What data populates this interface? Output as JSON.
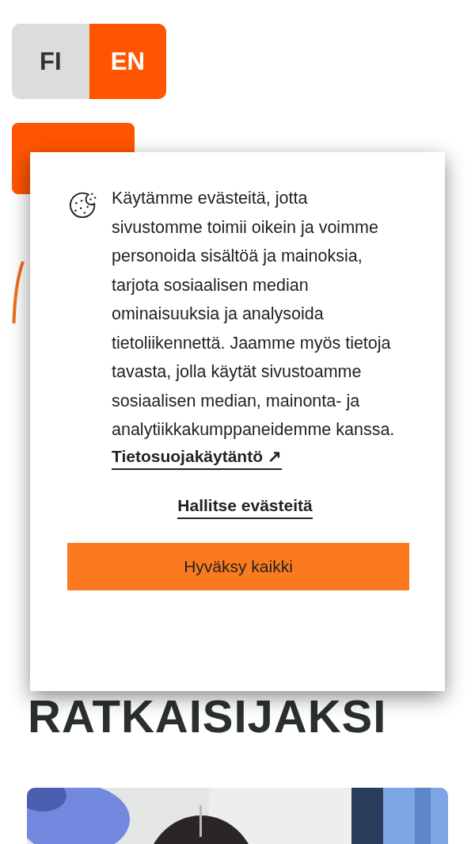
{
  "language_switch": [
    {
      "label": "FI",
      "selected": false
    },
    {
      "label": "EN",
      "selected": true
    }
  ],
  "heading": "RATKAISIJAKSI",
  "cookie_dialog": {
    "text": "Käytämme evästeitä, jotta sivustomme toimii oikein ja voimme personoida sisältöä ja mainoksia, tarjota sosiaalisen median ominaisuuksia ja analysoida tietoliikennettä. Jaamme myös tietoja tavasta, jolla käytät sivustoamme sosiaalisen median, mainonta- ja analytiikkakumppaneidemme kanssa.",
    "privacy_link": "Tietosuojakäytäntö ↗",
    "manage_link": "Hallitse evästeitä",
    "accept_button": "Hyväksy kaikki"
  }
}
